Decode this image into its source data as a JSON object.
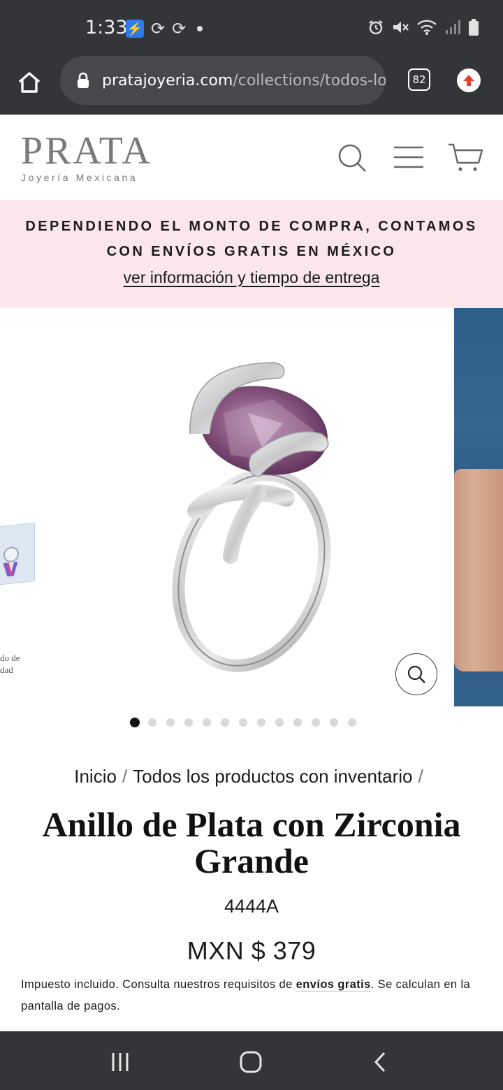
{
  "status_bar": {
    "time": "1:33",
    "icons_left": [
      "bolt-app-icon",
      "sync-icon",
      "sync-icon",
      "dot-icon"
    ],
    "icons_right": [
      "alarm-icon",
      "mute-icon",
      "wifi-icon",
      "signal-icon",
      "battery-icon"
    ]
  },
  "browser": {
    "url_domain": "pratajoyeria.com",
    "url_path": "/collections/todos-los-",
    "tab_count": "82",
    "accent_update": "#e8402f"
  },
  "header": {
    "logo_name": "PRATA",
    "logo_tagline": "Joyería Mexicana",
    "icons": [
      "search-icon",
      "menu-icon",
      "cart-icon"
    ]
  },
  "announcement": {
    "text": "DEPENDIENDO EL MONTO DE COMPRA, CONTAMOS CON ENVÍOS GRATIS EN MÉXICO",
    "link": "ver información y tiempo de entrega",
    "background": "#fbe6ec"
  },
  "gallery": {
    "peek_text_line1": "do de",
    "peek_text_line2": "dad",
    "dot_count": 13,
    "active_dot": 0
  },
  "product": {
    "breadcrumb_home": "Inicio",
    "breadcrumb_collection": "Todos los productos con inventario",
    "breadcrumb_sep": "/",
    "title_line1": "Anillo de Plata con Zirconia",
    "title_line2": "Grande",
    "sku": "4444A",
    "price": "MXN $ 379",
    "tax_prefix": "Impuesto incluido. Consulta nuestros requisitos de ",
    "tax_link": "envíos gratis",
    "tax_suffix": ". Se calculan en la pantalla de pagos."
  },
  "nav_bar": {
    "buttons": [
      "recent-apps-icon",
      "home-icon",
      "back-icon"
    ]
  }
}
